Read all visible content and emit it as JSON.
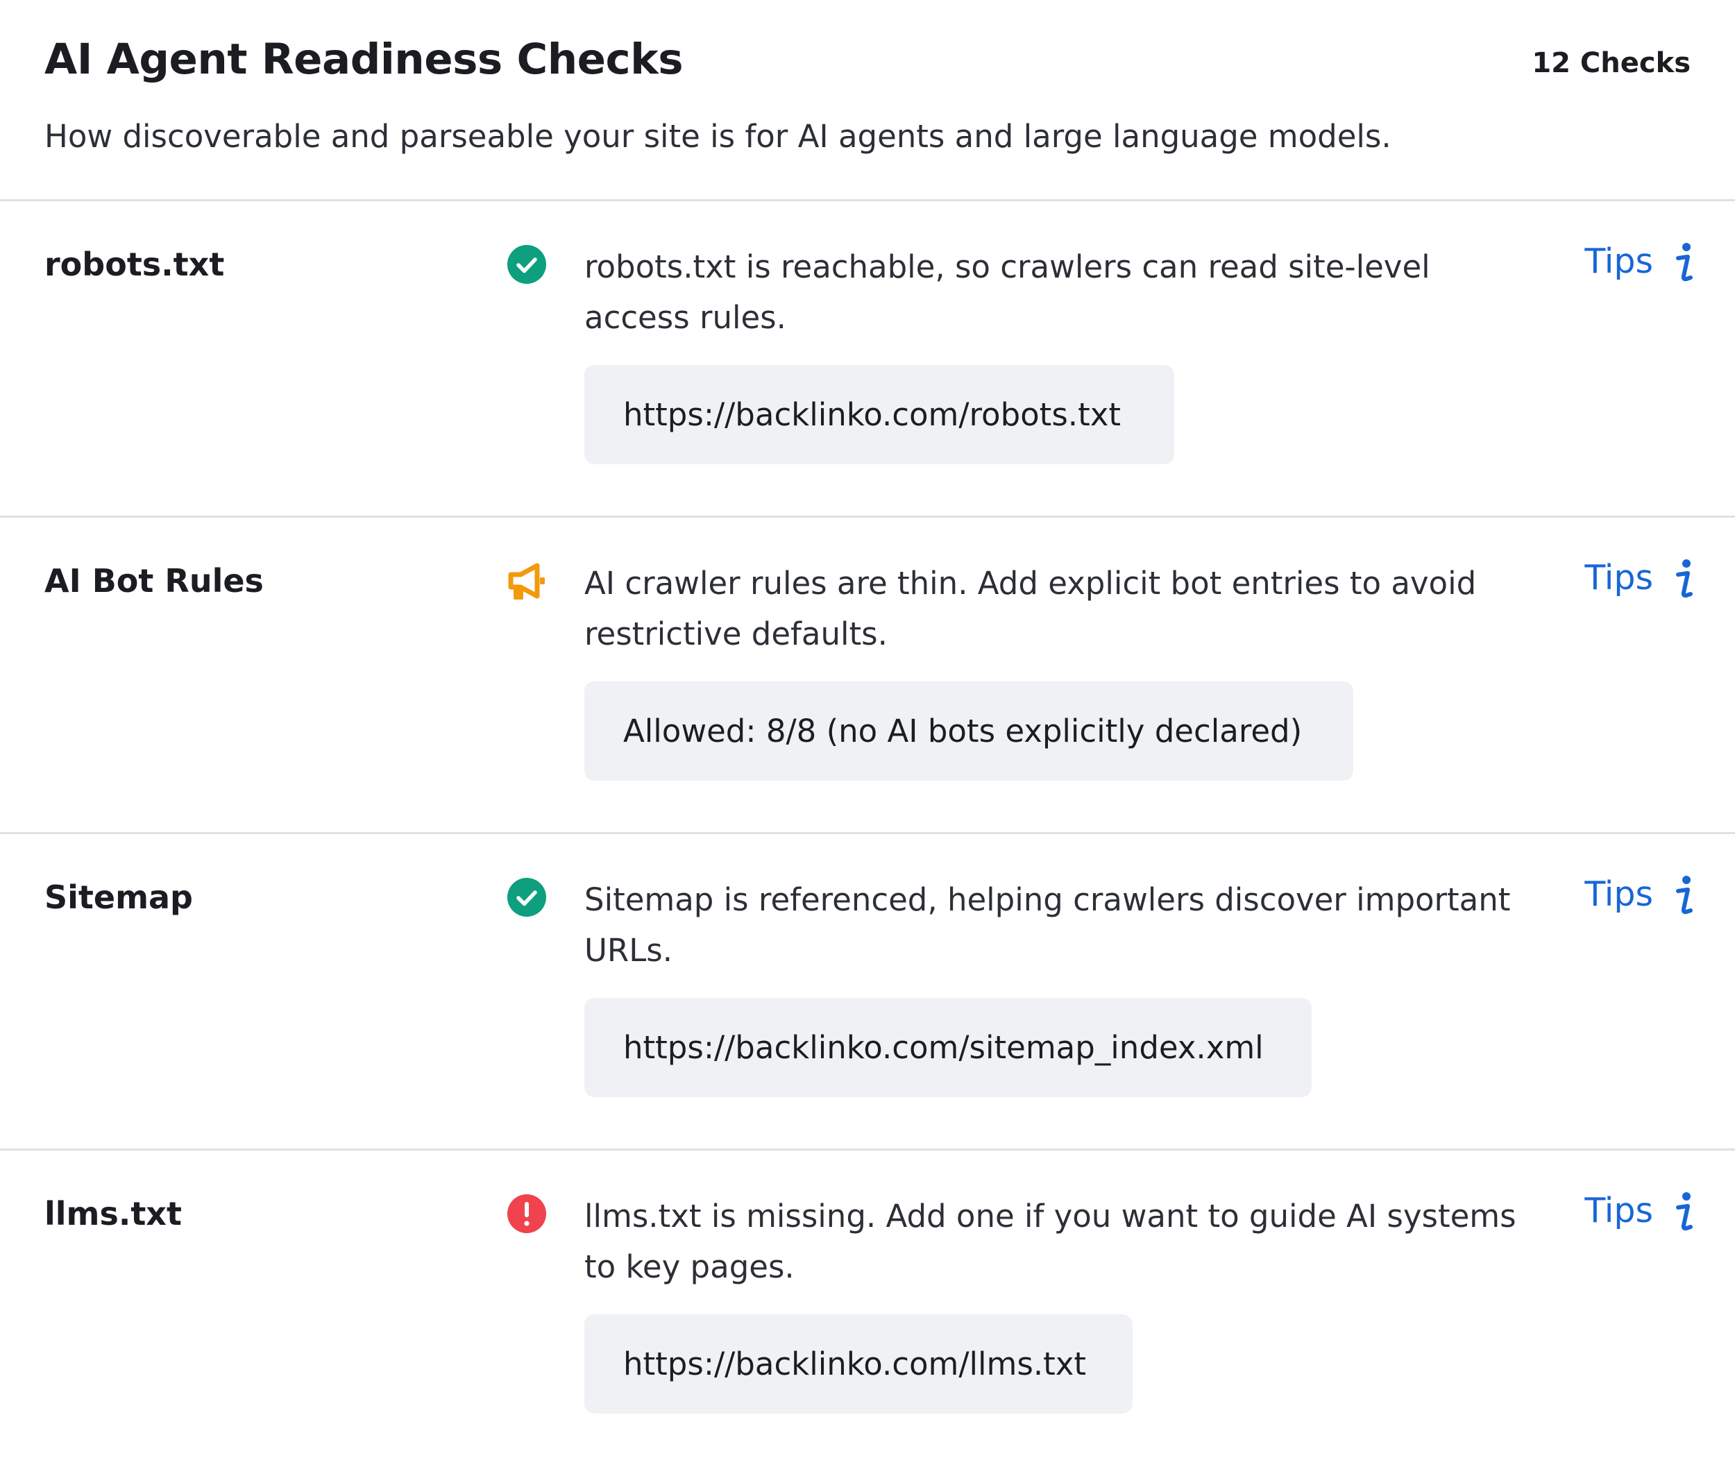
{
  "header": {
    "title": "AI Agent Readiness Checks",
    "count": "12 Checks",
    "subtitle": "How discoverable and parseable your site is for AI agents and large language models."
  },
  "colors": {
    "pass": "#0e9f7e",
    "warning": "#f29a0c",
    "fail": "#f0434d",
    "link": "#1766d6",
    "divider": "#dfe1e6",
    "code_bg": "#f0f1f4"
  },
  "checks": [
    {
      "name": "robots.txt",
      "status": "pass",
      "status_icon": "check-circle-icon",
      "description": "robots.txt is reachable, so crawlers can read site-level access rules.",
      "detail": "https://backlinko.com/robots.txt",
      "tips_label": "Tips"
    },
    {
      "name": "AI Bot Rules",
      "status": "warning",
      "status_icon": "megaphone-icon",
      "description": "AI crawler rules are thin. Add explicit bot entries to avoid restrictive defaults.",
      "detail": "Allowed: 8/8 (no AI bots explicitly declared)",
      "tips_label": "Tips"
    },
    {
      "name": "Sitemap",
      "status": "pass",
      "status_icon": "check-circle-icon",
      "description": "Sitemap is referenced, helping crawlers discover important URLs.",
      "detail": "https://backlinko.com/sitemap_index.xml",
      "tips_label": "Tips"
    },
    {
      "name": "llms.txt",
      "status": "fail",
      "status_icon": "error-circle-icon",
      "description": "llms.txt is missing. Add one if you want to guide AI systems to key pages.",
      "detail": "https://backlinko.com/llms.txt",
      "tips_label": "Tips"
    }
  ]
}
